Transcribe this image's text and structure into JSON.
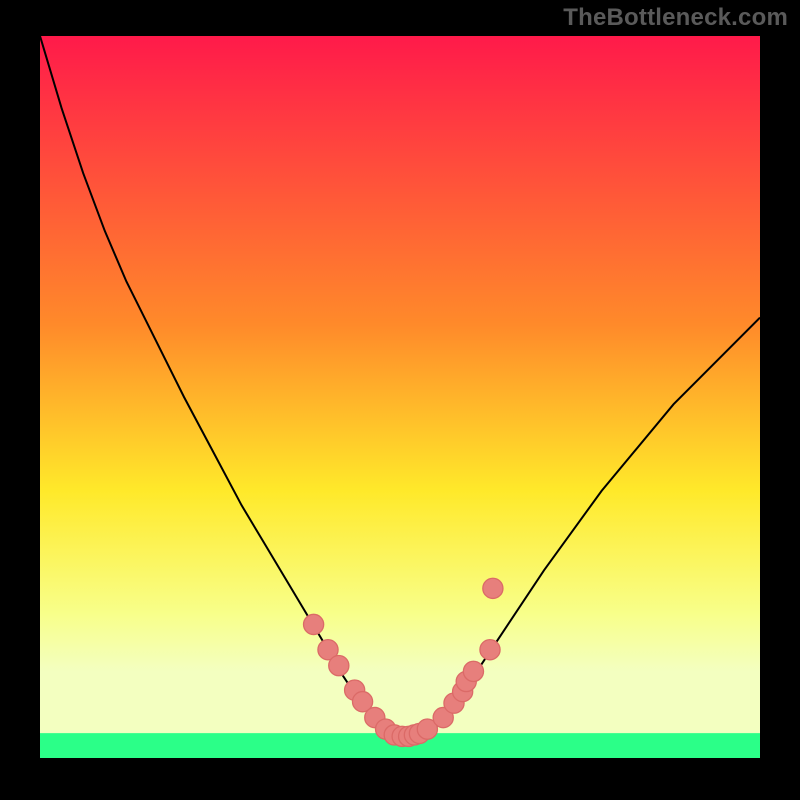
{
  "watermark": "TheBottleneck.com",
  "colors": {
    "background": "#000000",
    "watermark": "#5a5a5a",
    "curve": "#000000",
    "marker_fill": "#e77f7c",
    "marker_stroke": "#db6a67",
    "gradient_top": "#ff1a4a",
    "gradient_mid1": "#ff8a2a",
    "gradient_mid2": "#ffe92a",
    "gradient_mid3": "#f8ff8a",
    "gradient_band": "#f3ffc0",
    "gradient_bottom": "#2bff88"
  },
  "chart_data": {
    "type": "line",
    "title": "",
    "xlabel": "",
    "ylabel": "",
    "xlim": [
      0,
      100
    ],
    "ylim": [
      0,
      100
    ],
    "series": [
      {
        "name": "curve",
        "x": [
          0,
          3,
          6,
          9,
          12,
          16,
          20,
          24,
          28,
          31,
          34,
          37,
          40,
          42,
          44,
          46,
          48,
          49.5,
          51.5,
          53.5,
          56,
          58,
          60,
          64,
          70,
          78,
          88,
          100
        ],
        "y": [
          100,
          90,
          81,
          73,
          66,
          58,
          50,
          42.5,
          35,
          30,
          25,
          20,
          15,
          11.5,
          8.5,
          6,
          4,
          3,
          3,
          3.3,
          5,
          7.5,
          11,
          17,
          26,
          37,
          49,
          61
        ]
      }
    ],
    "markers": {
      "name": "dots",
      "points_xy": [
        [
          38.0,
          18.5
        ],
        [
          40.0,
          15.0
        ],
        [
          41.5,
          12.8
        ],
        [
          43.7,
          9.4
        ],
        [
          44.8,
          7.8
        ],
        [
          46.5,
          5.6
        ],
        [
          48.0,
          4.0
        ],
        [
          49.2,
          3.2
        ],
        [
          50.3,
          3.0
        ],
        [
          51.2,
          3.0
        ],
        [
          52.0,
          3.2
        ],
        [
          52.7,
          3.4
        ],
        [
          53.8,
          4.0
        ],
        [
          56.0,
          5.6
        ],
        [
          57.5,
          7.6
        ],
        [
          58.7,
          9.2
        ],
        [
          59.2,
          10.6
        ],
        [
          60.2,
          12.0
        ],
        [
          62.5,
          15.0
        ],
        [
          62.9,
          23.5
        ]
      ],
      "radius": 1.4
    }
  }
}
